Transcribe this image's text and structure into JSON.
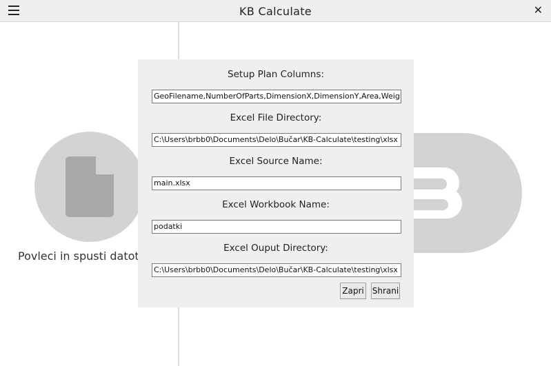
{
  "titlebar": {
    "title": "KB Calculate",
    "menu_icon": "hamburger-menu-icon",
    "close_icon": "close-icon",
    "close_glyph": "✕"
  },
  "drop_zone": {
    "icon": "file-icon",
    "label": "Povleci in spusti datot"
  },
  "logo": {
    "name": "kb-logo",
    "color": "#d3d3d3"
  },
  "settings_dialog": {
    "fields": [
      {
        "label": "Setup Plan Columns:",
        "value": "GeoFilename,NumberOfParts,DimensionX,DimensionY,Area,Weight"
      },
      {
        "label": "Excel File Directory:",
        "value": "C:\\Users\\brbb0\\Documents\\Delo\\Bučar\\KB-Calculate\\testing\\xlsx"
      },
      {
        "label": "Excel Source Name:",
        "value": "main.xlsx"
      },
      {
        "label": "Excel Workbook Name:",
        "value": "podatki"
      },
      {
        "label": "Excel Ouput Directory:",
        "value": "C:\\Users\\brbb0\\Documents\\Delo\\Bučar\\KB-Calculate\\testing\\xlsx"
      }
    ],
    "close_button": "Zapri",
    "save_button": "Shrani"
  },
  "colors": {
    "titlebar_bg": "#efefef",
    "dialog_bg": "#efefef",
    "placeholder_gray": "#d3d3d3",
    "icon_gray": "#a8a8a8"
  }
}
